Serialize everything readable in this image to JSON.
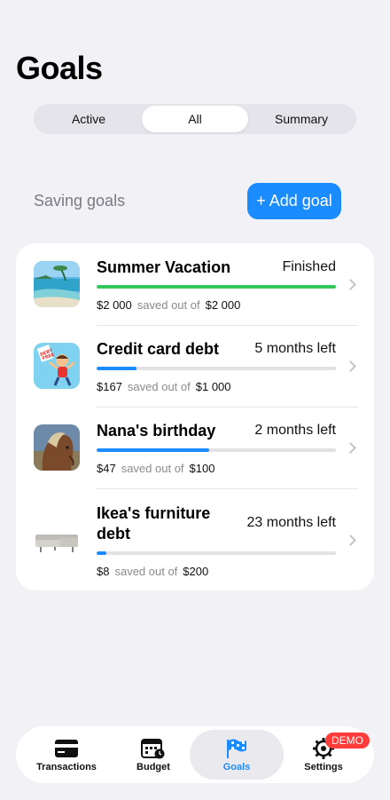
{
  "page": {
    "title": "Goals"
  },
  "segments": [
    {
      "label": "Active",
      "selected": false
    },
    {
      "label": "All",
      "selected": true
    },
    {
      "label": "Summary",
      "selected": false
    }
  ],
  "section": {
    "label": "Saving goals",
    "add_button": "+ Add goal"
  },
  "goals": [
    {
      "name": "Summer Vacation",
      "status": "Finished",
      "saved": "$2 000",
      "separator": "saved out of",
      "target": "$2 000",
      "progress": 1.0,
      "color": "#34c759",
      "image": "beach-photo"
    },
    {
      "name": "Credit card debt",
      "status": "5 months left",
      "saved": "$167",
      "separator": "saved out of",
      "target": "$1 000",
      "progress": 0.167,
      "color": "#1a8cff",
      "image": "debt-free-illustration"
    },
    {
      "name": "Nana's birthday",
      "status": "2 months left",
      "saved": "$47",
      "separator": "saved out of",
      "target": "$100",
      "progress": 0.47,
      "color": "#1a8cff",
      "image": "horse-photo"
    },
    {
      "name": "Ikea's furniture debt",
      "status": "23 months left",
      "saved": "$8",
      "separator": "saved out of",
      "target": "$200",
      "progress": 0.04,
      "color": "#1a8cff",
      "image": "sofa-photo"
    }
  ],
  "tabbar": {
    "items": [
      {
        "label": "Transactions",
        "icon": "card-icon",
        "selected": false
      },
      {
        "label": "Budget",
        "icon": "calendar-clock-icon",
        "selected": false
      },
      {
        "label": "Goals",
        "icon": "checkered-flag-icon",
        "selected": true
      },
      {
        "label": "Settings",
        "icon": "gear-icon",
        "selected": false
      }
    ],
    "badge": "DEMO"
  }
}
